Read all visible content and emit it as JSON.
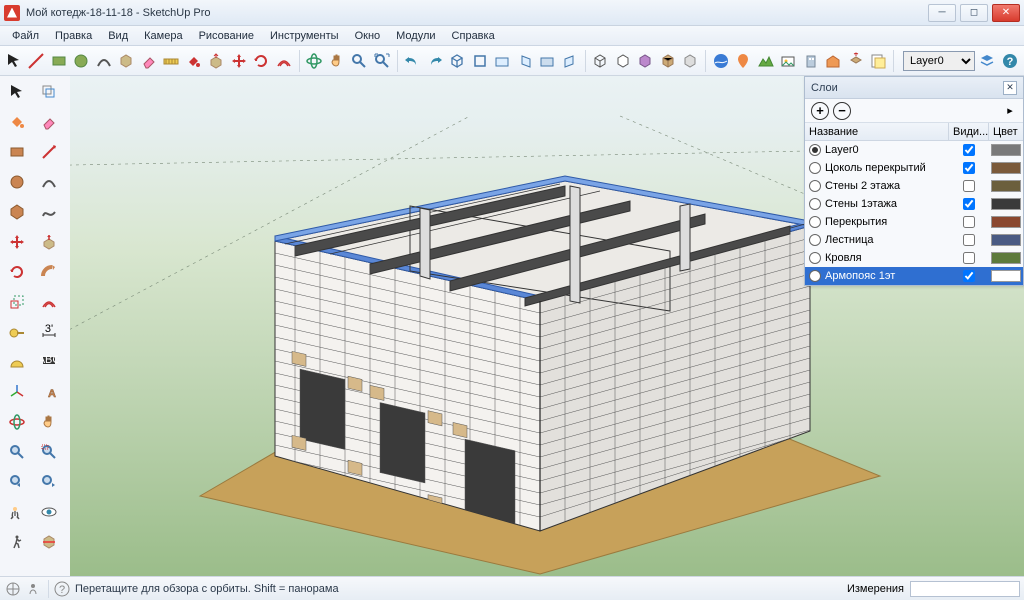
{
  "window": {
    "title": "Мой котедж-18-11-18 - SketchUp Pro"
  },
  "menu": [
    "Файл",
    "Правка",
    "Вид",
    "Камера",
    "Рисование",
    "Инструменты",
    "Окно",
    "Модули",
    "Справка"
  ],
  "toolbar": {
    "layer_selected": "Layer0"
  },
  "layers_panel": {
    "title": "Слои",
    "head_name": "Название",
    "head_vis": "Види...",
    "head_col": "Цвет",
    "rows": [
      {
        "name": "Layer0",
        "active": true,
        "visible": true,
        "color": "#7a7a7a"
      },
      {
        "name": "Цоколь перекрытий",
        "active": false,
        "visible": true,
        "color": "#7b5a3a"
      },
      {
        "name": "Стены 2 этажа",
        "active": false,
        "visible": false,
        "color": "#6b5f3d"
      },
      {
        "name": "Стены 1этажа",
        "active": false,
        "visible": true,
        "color": "#3a3a3a"
      },
      {
        "name": "Перекрытия",
        "active": false,
        "visible": false,
        "color": "#8a4830"
      },
      {
        "name": "Лестница",
        "active": false,
        "visible": false,
        "color": "#4a5b84"
      },
      {
        "name": "Кровля",
        "active": false,
        "visible": false,
        "color": "#5d7a3c"
      },
      {
        "name": "Армопояс 1эт",
        "active": false,
        "visible": true,
        "color": "#ffffff",
        "selected": true
      }
    ]
  },
  "status": {
    "hint": "Перетащите для обзора с орбиты. Shift = панорама",
    "measure_label": "Измерения"
  }
}
